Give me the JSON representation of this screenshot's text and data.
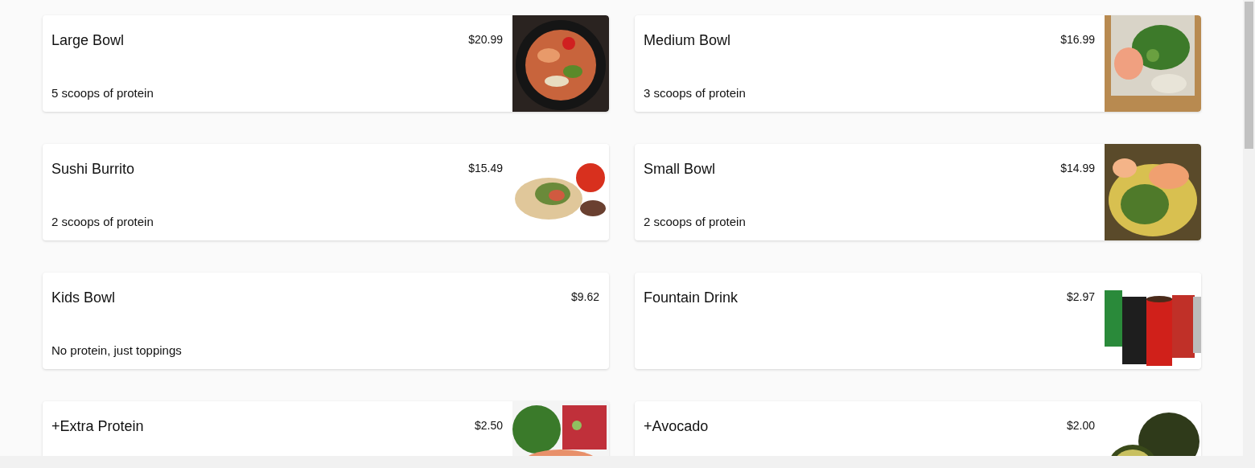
{
  "menu_items": [
    {
      "name": "Large Bowl",
      "price": "$20.99",
      "description": "5 scoops of protein",
      "kind": "picture"
    },
    {
      "name": "Medium Bowl",
      "price": "$16.99",
      "description": "3 scoops of protein",
      "kind": "picture"
    },
    {
      "name": "Sushi Burrito",
      "price": "$15.49",
      "description": "2 scoops of protein",
      "kind": "picture"
    },
    {
      "name": "Small Bowl",
      "price": "$14.99",
      "description": "2 scoops of protein",
      "kind": "picture"
    },
    {
      "name": "Kids Bowl",
      "price": "$9.62",
      "description": "No protein, just toppings",
      "kind": "text"
    },
    {
      "name": "Fountain Drink",
      "price": "$2.97",
      "kind": "picture"
    },
    {
      "name": "+Extra Protein",
      "price": "$2.50",
      "kind": "picture"
    },
    {
      "name": "+Avocado",
      "price": "$2.00",
      "kind": "picture"
    }
  ]
}
